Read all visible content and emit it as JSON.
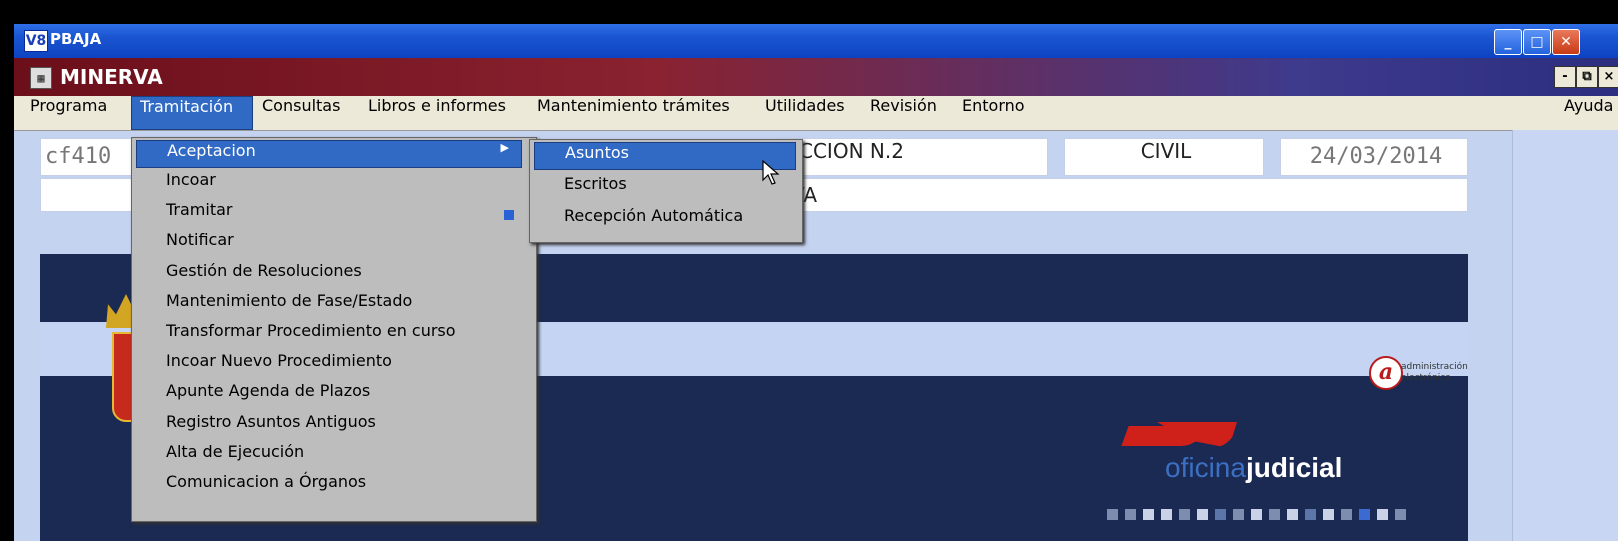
{
  "window": {
    "title": "PBAJA",
    "logo": "V8"
  },
  "app": {
    "title": "MINERVA",
    "icon": "app-grid-icon"
  },
  "menubar": {
    "items": [
      "Programa",
      "Tramitación",
      "Consultas",
      "Libros e informes",
      "Mantenimiento trámites",
      "Utilidades",
      "Revisión",
      "Entorno"
    ],
    "selected": "Tramitación",
    "help": "Ayuda"
  },
  "fields": {
    "code": "cf410",
    "seccion": "CCION N.2",
    "jurisdiccion": "CIVIL",
    "date": "24/03/2014",
    "name": "VA"
  },
  "dropdown": {
    "items": [
      "Aceptacion",
      "Incoar",
      "Tramitar",
      "Notificar",
      "Gestión de Resoluciones",
      "Mantenimiento de Fase/Estado",
      "Transformar Procedimiento en curso",
      "Incoar Nuevo Procedimiento",
      "Apunte Agenda de Plazos",
      "Registro Asuntos Antiguos",
      "Alta de Ejecución",
      "Comunicacion a Órganos"
    ],
    "selected": "Aceptacion"
  },
  "submenu": {
    "items": [
      "Asuntos",
      "Escritos",
      "Recepción Automática"
    ],
    "selected": "Asuntos"
  },
  "branding": {
    "ae_letter": "a",
    "ae_line1": "administración",
    "ae_line2": "electrónica",
    "oficina_light": "oficina",
    "oficina_bold": "judicial"
  },
  "colors": {
    "highlight": "#316ac5",
    "banner": "#1b2a52",
    "accent_red": "#d0201a"
  }
}
